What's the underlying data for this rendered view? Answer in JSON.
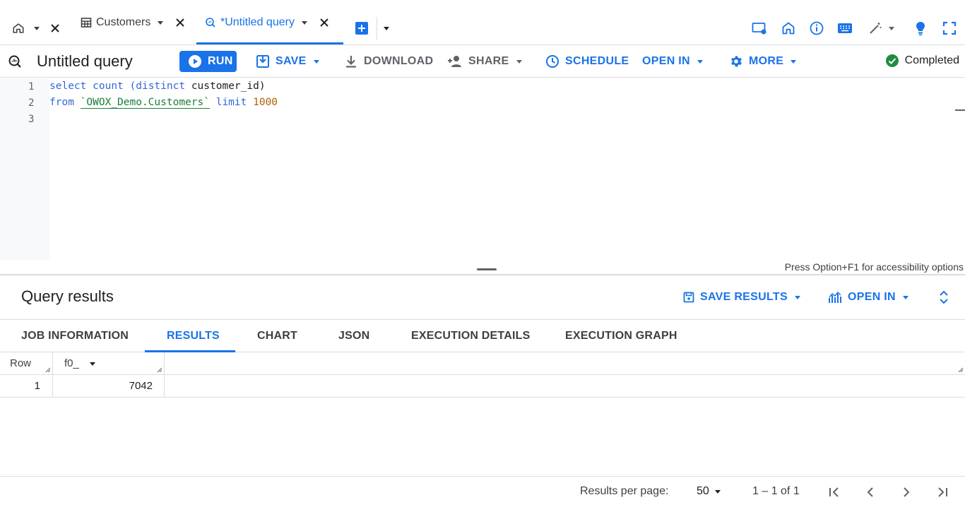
{
  "tabs": {
    "customers_label": "Customers",
    "query_label": "*Untitled query"
  },
  "toolbar": {
    "title": "Untitled query",
    "run": "RUN",
    "save": "SAVE",
    "download": "DOWNLOAD",
    "share": "SHARE",
    "schedule": "SCHEDULE",
    "open_in": "OPEN IN",
    "more": "MORE",
    "status": "Completed"
  },
  "editor": {
    "line_numbers": [
      "1",
      "2",
      "3"
    ],
    "line1_kw1": "select",
    "line1_kw2": "count",
    "line1_kw3": "(distinct",
    "line1_id": "customer_id)",
    "line2_kw1": "from",
    "line2_table": "`OWOX_Demo.Customers`",
    "line2_kw2": "limit",
    "line2_num": "1000",
    "accessibility_hint": "Press Option+F1 for accessibility options"
  },
  "results": {
    "title": "Query results",
    "save_results": "SAVE RESULTS",
    "open_in": "OPEN IN",
    "tabs": [
      "JOB INFORMATION",
      "RESULTS",
      "CHART",
      "JSON",
      "EXECUTION DETAILS",
      "EXECUTION GRAPH"
    ],
    "table": {
      "headers": [
        "Row",
        "f0_"
      ],
      "rows": [
        [
          "1",
          "7042"
        ]
      ]
    }
  },
  "footer": {
    "per_page_label": "Results per page:",
    "per_page_value": "50",
    "range": "1 – 1 of 1"
  },
  "colors": {
    "accent": "#1a73e8",
    "success": "#1e8e3e",
    "keyword": "#3367d6",
    "string": "#188038",
    "number": "#b06000"
  }
}
